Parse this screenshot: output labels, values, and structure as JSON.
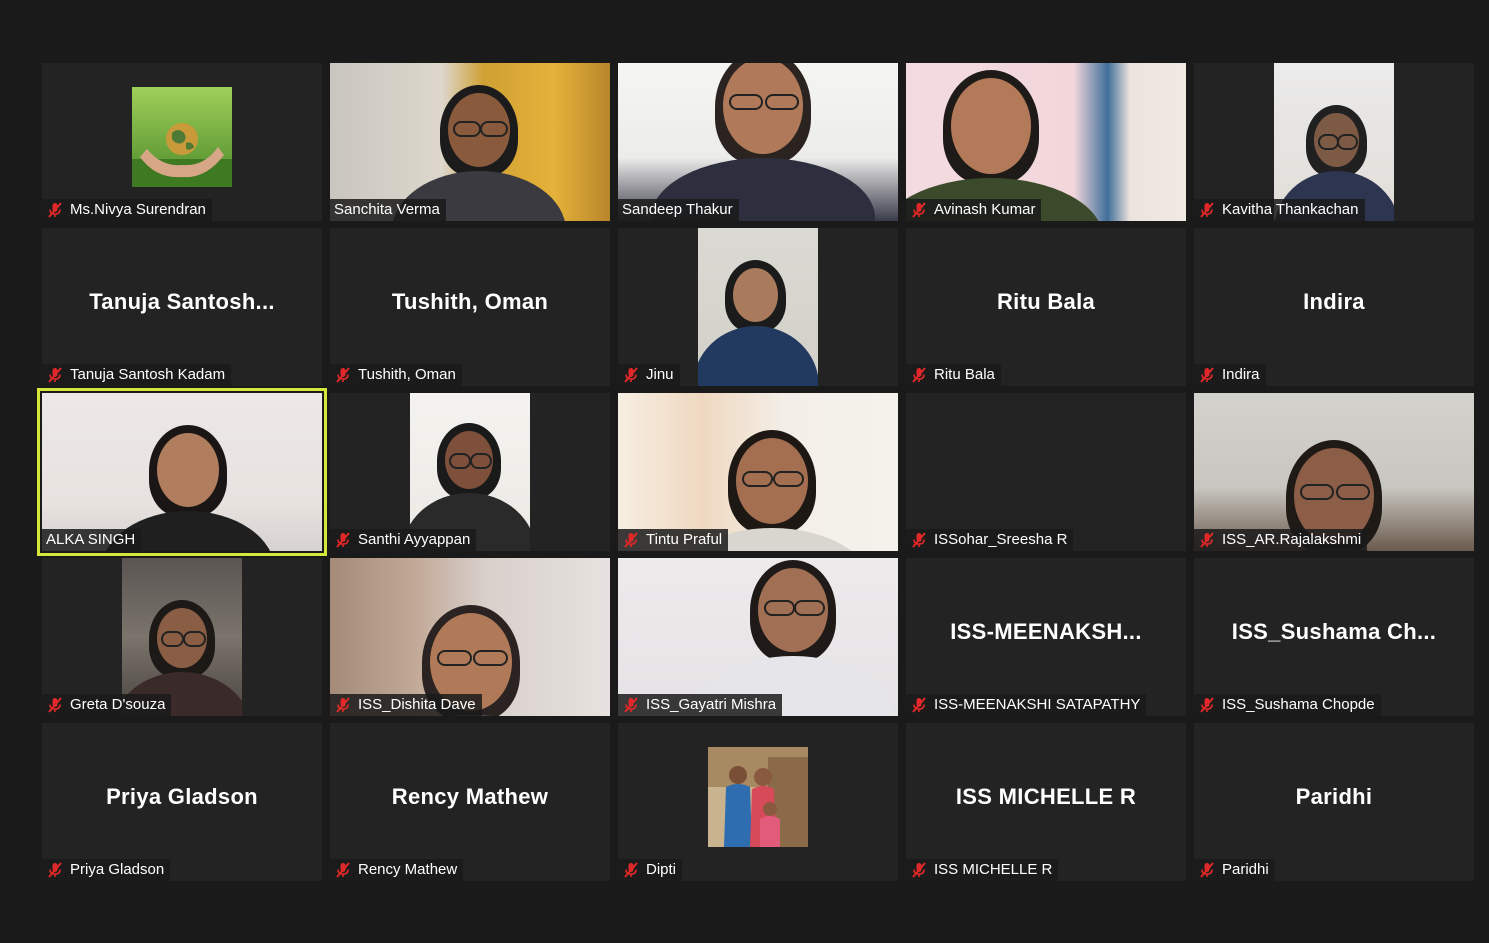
{
  "participants": [
    {
      "name": "Ms.Nivya Surendran",
      "muted": true,
      "display": "avatar",
      "avatar": "globe-in-hands"
    },
    {
      "name": "Sanchita Verma",
      "muted": false,
      "display": "video"
    },
    {
      "name": "Sandeep Thakur",
      "muted": false,
      "display": "video"
    },
    {
      "name": "Avinash Kumar",
      "muted": true,
      "display": "video"
    },
    {
      "name": "Kavitha Thankachan",
      "muted": true,
      "display": "video-narrow"
    },
    {
      "name": "Tanuja Santosh Kadam",
      "muted": true,
      "display": "name",
      "title": "Tanuja  Santosh..."
    },
    {
      "name": "Tushith, Oman",
      "muted": true,
      "display": "name",
      "title": "Tushith, Oman"
    },
    {
      "name": "Jinu",
      "muted": true,
      "display": "video-narrow"
    },
    {
      "name": "Ritu Bala",
      "muted": true,
      "display": "name",
      "title": "Ritu Bala"
    },
    {
      "name": "Indira",
      "muted": true,
      "display": "name",
      "title": "Indira"
    },
    {
      "name": "ALKA SINGH",
      "muted": false,
      "display": "video",
      "active": true
    },
    {
      "name": "Santhi Ayyappan",
      "muted": true,
      "display": "video-narrow"
    },
    {
      "name": "Tintu Praful",
      "muted": true,
      "display": "video"
    },
    {
      "name": "ISSohar_Sreesha R",
      "muted": true,
      "display": "blank"
    },
    {
      "name": "ISS_AR.Rajalakshmi",
      "muted": true,
      "display": "video"
    },
    {
      "name": "Greta D'souza",
      "muted": true,
      "display": "video-narrow"
    },
    {
      "name": "ISS_Dishita Dave",
      "muted": true,
      "display": "video"
    },
    {
      "name": "ISS_Gayatri Mishra",
      "muted": true,
      "display": "video"
    },
    {
      "name": "ISS-MEENAKSHI SATAPATHY",
      "muted": true,
      "display": "name",
      "title": "ISS-MEENAKSH..."
    },
    {
      "name": "ISS_Sushama Chopde",
      "muted": true,
      "display": "name",
      "title": "ISS_Sushama  Ch..."
    },
    {
      "name": "Priya Gladson",
      "muted": true,
      "display": "name",
      "title": "Priya Gladson"
    },
    {
      "name": "Rency Mathew",
      "muted": true,
      "display": "name",
      "title": "Rency Mathew"
    },
    {
      "name": "Dipti",
      "muted": true,
      "display": "avatar",
      "avatar": "family-photo"
    },
    {
      "name": "ISS MICHELLE R",
      "muted": true,
      "display": "name",
      "title": "ISS MICHELLE R"
    },
    {
      "name": "Paridhi",
      "muted": true,
      "display": "name",
      "title": "Paridhi"
    }
  ],
  "colors": {
    "background": "#1a1a1a",
    "tile": "#232323",
    "active_speaker": "#d5e83a",
    "mute": "#e02828"
  }
}
